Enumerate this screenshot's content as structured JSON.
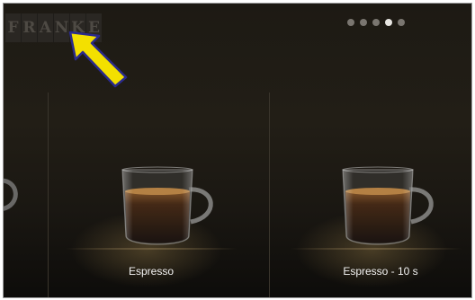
{
  "brand": {
    "logo_letters": [
      "F",
      "R",
      "A",
      "N",
      "K",
      "E"
    ]
  },
  "carousel": {
    "page_count": 5,
    "active_page": 4
  },
  "products": [
    {
      "label": "Espresso"
    },
    {
      "label": "Espresso - 10 s"
    }
  ],
  "colors": {
    "annotation_arrow": "#f3e000",
    "annotation_outline": "#2a2a8c",
    "background": "#1d1a14"
  },
  "icons": {
    "annotation": "arrow-pointer-icon",
    "product": "espresso-cup-icon"
  }
}
